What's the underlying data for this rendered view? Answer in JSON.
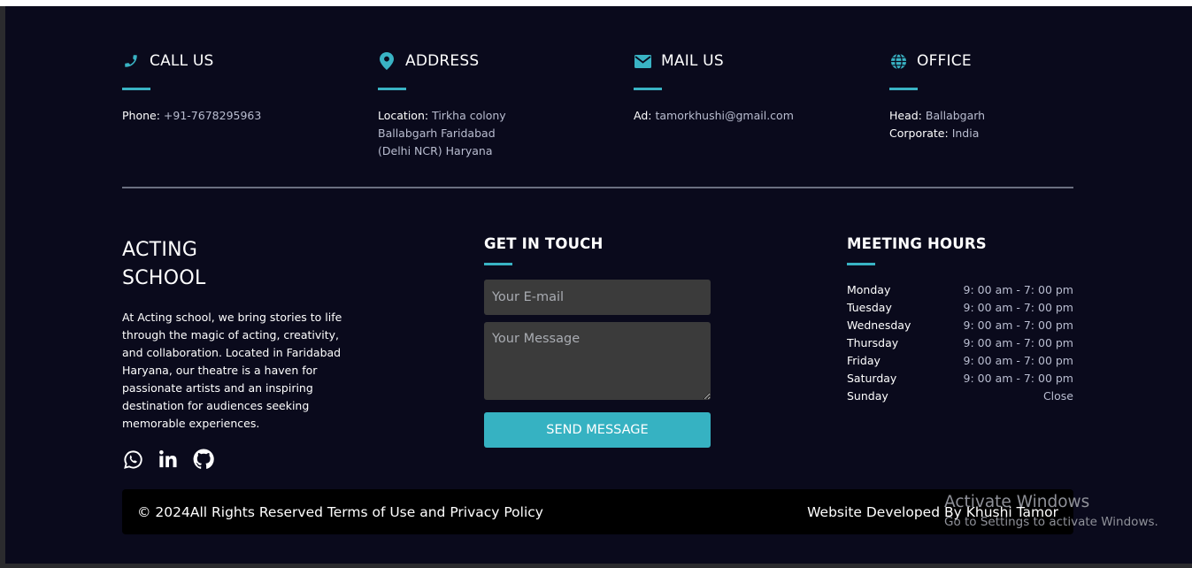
{
  "contacts": {
    "call": {
      "icon": "phone-icon",
      "title": "CALL US",
      "lines": [
        {
          "label": "Phone:",
          "value": "+91-7678295963"
        }
      ]
    },
    "address": {
      "icon": "map-marker-icon",
      "title": "ADDRESS",
      "lines": [
        {
          "label": "Location:",
          "value": "Tirkha colony"
        },
        {
          "label": "",
          "value": "Ballabgarh Faridabad"
        },
        {
          "label": "",
          "value": "(Delhi NCR) Haryana"
        }
      ]
    },
    "mail": {
      "icon": "envelope-icon",
      "title": "MAIL US",
      "lines": [
        {
          "label": "Ad:",
          "value": "tamorkhushi@gmail.com"
        }
      ]
    },
    "office": {
      "icon": "globe-icon",
      "title": "OFFICE",
      "lines": [
        {
          "label": "Head:",
          "value": "Ballabgarh"
        },
        {
          "label": "Corporate:",
          "value": "India"
        }
      ]
    }
  },
  "about": {
    "title_line1": "ACTING",
    "title_line2": "SCHOOL",
    "text": "At Acting school, we bring stories to life through the magic of acting, creativity, and collaboration. Located in Faridabad Haryana, our theatre is a haven for passionate artists and an inspiring destination for audiences seeking memorable experiences.",
    "socials": [
      "whatsapp-icon",
      "linkedin-icon",
      "github-icon"
    ]
  },
  "touch": {
    "title": "GET IN TOUCH",
    "email_placeholder": "Your E-mail",
    "message_placeholder": "Your Message",
    "send_label": "SEND MESSAGE"
  },
  "hours": {
    "title": "MEETING HOURS",
    "rows": [
      {
        "day": "Monday",
        "time": "9: 00 am - 7: 00 pm"
      },
      {
        "day": "Tuesday",
        "time": "9: 00 am - 7: 00 pm"
      },
      {
        "day": "Wednesday",
        "time": "9: 00 am - 7: 00 pm"
      },
      {
        "day": "Thursday",
        "time": "9: 00 am - 7: 00 pm"
      },
      {
        "day": "Friday",
        "time": "9: 00 am - 7: 00 pm"
      },
      {
        "day": "Saturday",
        "time": "9: 00 am - 7: 00 pm"
      },
      {
        "day": "Sunday",
        "time": "Close"
      }
    ]
  },
  "bottom": {
    "copyright": "© 2024All Rights Reserved Terms of Use and Privacy Policy",
    "credit": "Website Developed By Khushi Tamor"
  },
  "watermark": {
    "line1": "Activate Windows",
    "line2": "Go to Settings to activate Windows."
  },
  "colors": {
    "accent": "#39b3c4",
    "background": "#0a0a1c",
    "bar": "#000000"
  }
}
